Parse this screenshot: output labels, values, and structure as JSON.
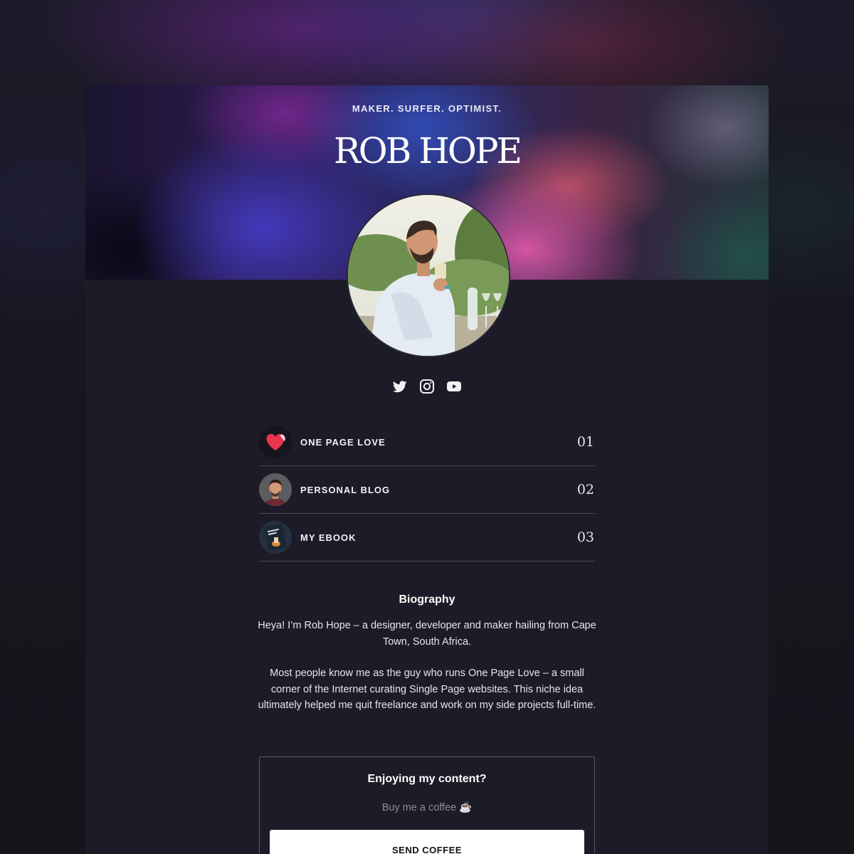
{
  "header": {
    "tagline": "MAKER. SURFER. OPTIMIST.",
    "name": "ROB HOPE"
  },
  "socials": [
    {
      "icon": "twitter-icon"
    },
    {
      "icon": "instagram-icon"
    },
    {
      "icon": "youtube-icon"
    }
  ],
  "links": [
    {
      "label": "ONE PAGE LOVE",
      "number": "01",
      "thumb": "heart-logo"
    },
    {
      "label": "PERSONAL BLOG",
      "number": "02",
      "thumb": "portrait"
    },
    {
      "label": "MY EBOOK",
      "number": "03",
      "thumb": "ebook-cover"
    }
  ],
  "bio": {
    "heading": "Biography",
    "paragraphs": [
      "Heya! I’m Rob Hope – a designer, developer and maker hailing from Cape Town, South Africa.",
      "Most people know me as the guy who runs One Page Love – a small corner of the Internet curating Single Page websites. This niche idea ultimately helped me quit freelance and work on my side projects full-time."
    ]
  },
  "coffee": {
    "title": "Enjoying my content?",
    "subtitle": "Buy me a coffee ☕",
    "button": "SEND COFFEE"
  },
  "colors": {
    "background": "#15151c",
    "card": "#1c1b27",
    "heart": "#e8354f",
    "divider": "#4a4958"
  }
}
